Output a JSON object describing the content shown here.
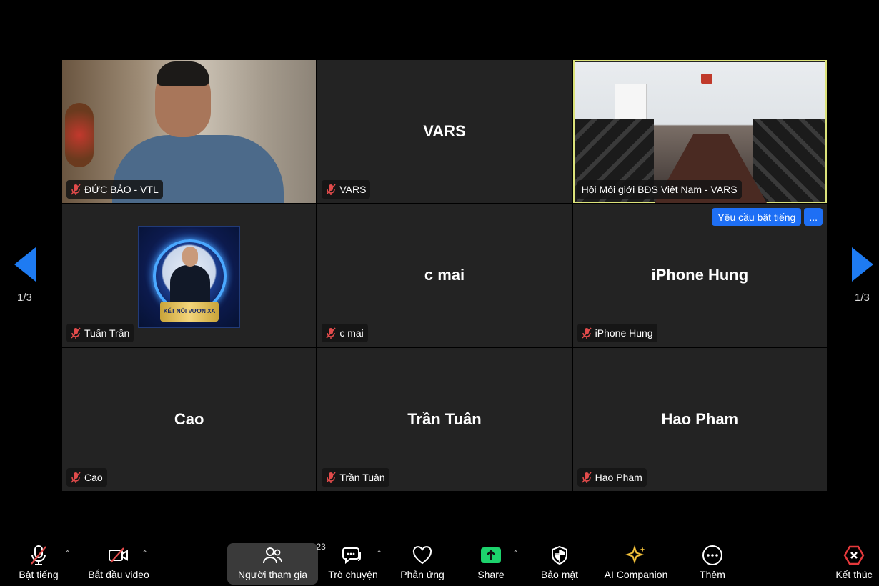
{
  "tiles": [
    {
      "name": "ĐỨC BẢO - VTL",
      "display": "",
      "type": "video1"
    },
    {
      "name": "VARS",
      "display": "VARS",
      "type": "name"
    },
    {
      "name": "Hội Môi giới BĐS Việt Nam - VARS",
      "display": "",
      "type": "video2"
    },
    {
      "name": "Tuấn Trần",
      "display": "",
      "type": "avatar"
    },
    {
      "name": "c mai",
      "display": "c mai",
      "type": "name"
    },
    {
      "name": "iPhone Hung",
      "display": "iPhone Hung",
      "type": "name"
    },
    {
      "name": "Cao",
      "display": "Cao",
      "type": "name"
    },
    {
      "name": "Trần Tuân",
      "display": "Trần Tuân",
      "type": "name"
    },
    {
      "name": "Hao Pham",
      "display": "Hao Pham",
      "type": "name"
    }
  ],
  "avatar_banner_text": "KẾT NỐI VƯƠN XA",
  "request_unmute_label": "Yêu cầu bật tiếng",
  "more_label": "...",
  "pagination": {
    "left": "1/3",
    "right": "1/3"
  },
  "toolbar": {
    "unmute": "Bật tiếng",
    "start_video": "Bắt đầu video",
    "participants": "Người tham gia",
    "participants_count": "23",
    "chat": "Trò chuyện",
    "reactions": "Phản ứng",
    "share": "Share",
    "security": "Bảo mật",
    "ai_companion": "AI Companion",
    "more": "Thêm",
    "end": "Kết thúc"
  },
  "colors": {
    "accent_blue": "#1e7bf2",
    "active_border": "#dbe27a",
    "share_green": "#1dd36d",
    "end_red": "#e5393b",
    "ai_gold": "#f3c13a"
  }
}
